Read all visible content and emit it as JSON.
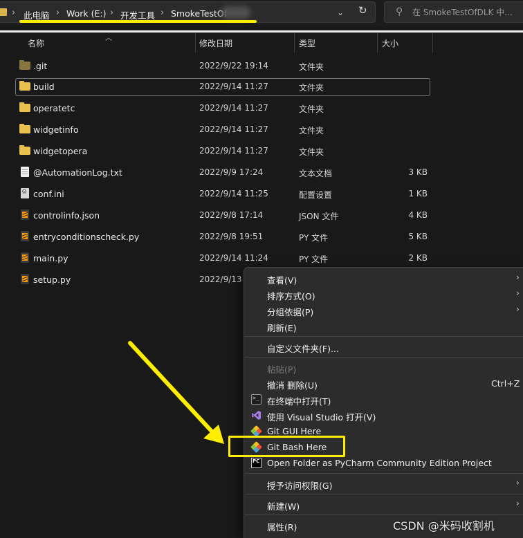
{
  "breadcrumb": {
    "items": [
      "此电脑",
      "Work (E:)",
      "开发工具",
      "SmokeTestOf"
    ],
    "separator": "›",
    "dropdown_icon": "chevron-down-icon",
    "refresh_icon": "refresh-icon"
  },
  "search": {
    "placeholder": "在 SmokeTestOfDLK 中...",
    "icon": "search-icon"
  },
  "columns": {
    "name": "名称",
    "modified": "修改日期",
    "type": "类型",
    "size": "大小"
  },
  "files": [
    {
      "name": ".git",
      "modified": "2022/9/22 19:14",
      "type": "文件夹",
      "size": "",
      "icon": "folder-icon"
    },
    {
      "name": "build",
      "modified": "2022/9/14 11:27",
      "type": "文件夹",
      "size": "",
      "icon": "folder-icon"
    },
    {
      "name": "operatetc",
      "modified": "2022/9/14 11:27",
      "type": "文件夹",
      "size": "",
      "icon": "folder-icon"
    },
    {
      "name": "widgetinfo",
      "modified": "2022/9/14 11:27",
      "type": "文件夹",
      "size": "",
      "icon": "folder-icon"
    },
    {
      "name": "widgetopera",
      "modified": "2022/9/14 11:27",
      "type": "文件夹",
      "size": "",
      "icon": "folder-icon"
    },
    {
      "name": "@AutomationLog.txt",
      "modified": "2022/9/9 17:24",
      "type": "文本文档",
      "size": "3 KB",
      "icon": "text-file-icon"
    },
    {
      "name": "conf.ini",
      "modified": "2022/9/14 11:25",
      "type": "配置设置",
      "size": "1 KB",
      "icon": "settings-file-icon"
    },
    {
      "name": "controlinfo.json",
      "modified": "2022/9/8 17:14",
      "type": "JSON 文件",
      "size": "4 KB",
      "icon": "sublime-file-icon"
    },
    {
      "name": "entryconditionscheck.py",
      "modified": "2022/9/8 19:51",
      "type": "PY 文件",
      "size": "5 KB",
      "icon": "sublime-file-icon"
    },
    {
      "name": "main.py",
      "modified": "2022/9/14 11:24",
      "type": "PY 文件",
      "size": "2 KB",
      "icon": "sublime-file-icon"
    },
    {
      "name": "setup.py",
      "modified": "2022/9/13",
      "type": "",
      "size": "",
      "icon": "sublime-file-icon"
    }
  ],
  "context_menu": {
    "view": "查看(V)",
    "sort": "排序方式(O)",
    "group": "分组依据(P)",
    "refresh": "刷新(E)",
    "customize": "自定义文件夹(F)...",
    "paste": "粘贴(P)",
    "undo": "撤消 删除(U)",
    "undo_shortcut": "Ctrl+Z",
    "terminal": "在终端中打开(T)",
    "visual_studio": "使用 Visual Studio 打开(V)",
    "git_gui": "Git GUI Here",
    "git_bash": "Git Bash Here",
    "pycharm": "Open Folder as PyCharm Community Edition Project",
    "grant_access": "授予访问权限(G)",
    "new": "新建(W)",
    "properties": "属性(R)"
  },
  "annotation": {
    "highlight_color": "#ffee00"
  },
  "watermark": "CSDN @米码收割机"
}
